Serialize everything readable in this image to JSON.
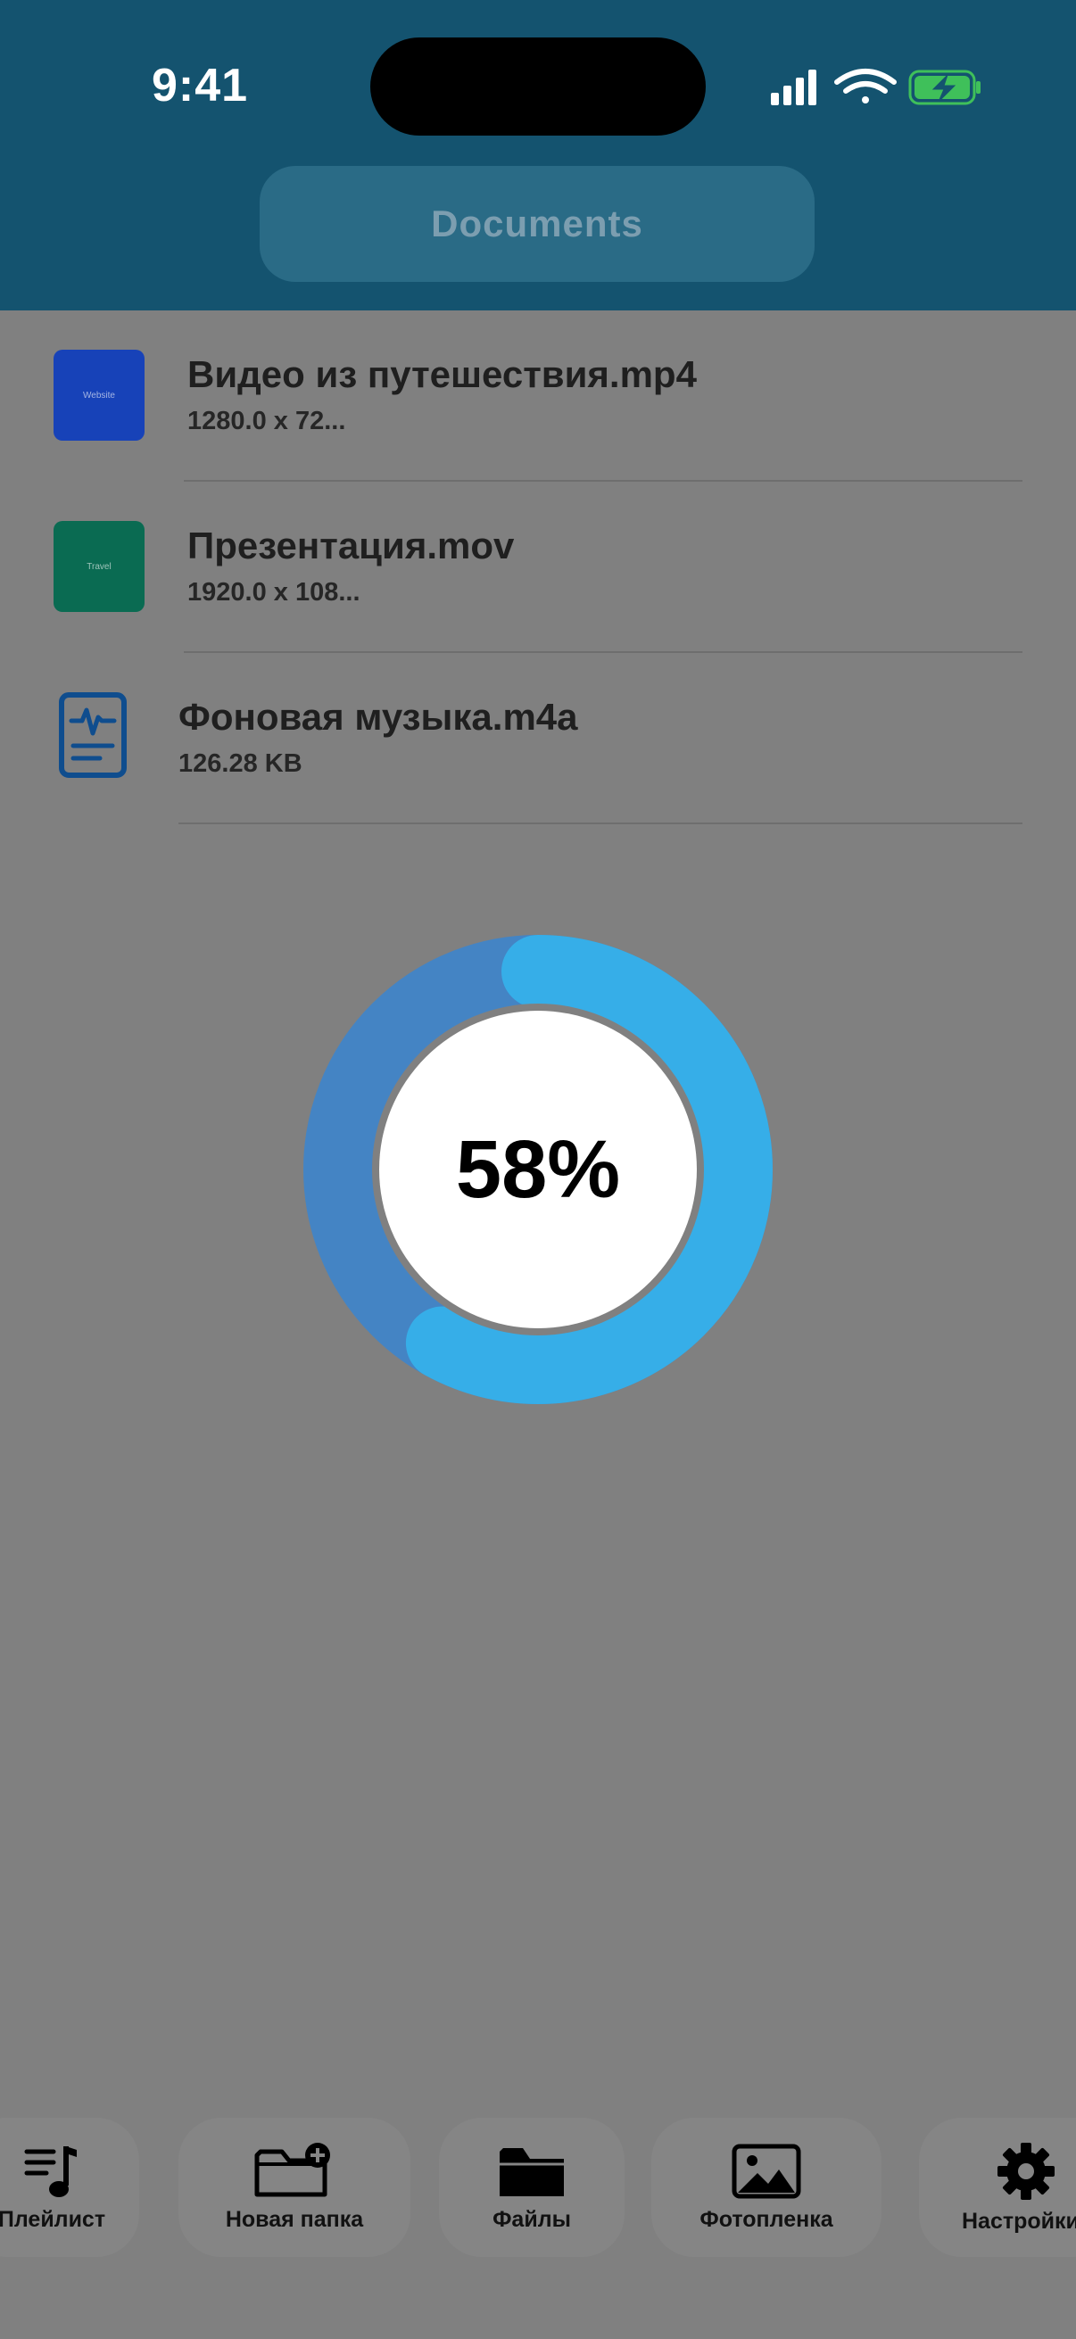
{
  "status_bar": {
    "time": "9:41"
  },
  "header": {
    "title": "Documents"
  },
  "files": [
    {
      "name": "Видео из путешествия.mp4",
      "meta": "1280.0 x 72...",
      "thumb_text": "Website",
      "thumb_color": "#1742b8"
    },
    {
      "name": "Презентация.mov",
      "meta": "1920.0 x 108...",
      "thumb_text": "Travel",
      "thumb_color": "#0a6b52"
    },
    {
      "name": "Фоновая музыка.m4a",
      "meta": "126.28 KB",
      "icon": "audio-file-icon"
    }
  ],
  "progress": {
    "label": "58%",
    "value": 0.58,
    "track_color": "#4484c4",
    "fill_color": "#36aee8"
  },
  "toolbar": {
    "items": [
      {
        "label": "Плейлист",
        "icon": "playlist-icon"
      },
      {
        "label": "Новая папка",
        "icon": "new-folder-icon"
      },
      {
        "label": "Файлы",
        "icon": "folder-icon"
      },
      {
        "label": "Фотопленка",
        "icon": "photo-icon"
      },
      {
        "label": "Настройки",
        "icon": "gear-icon"
      }
    ]
  },
  "colors": {
    "header": "#14536f",
    "overlay": "#808080"
  }
}
